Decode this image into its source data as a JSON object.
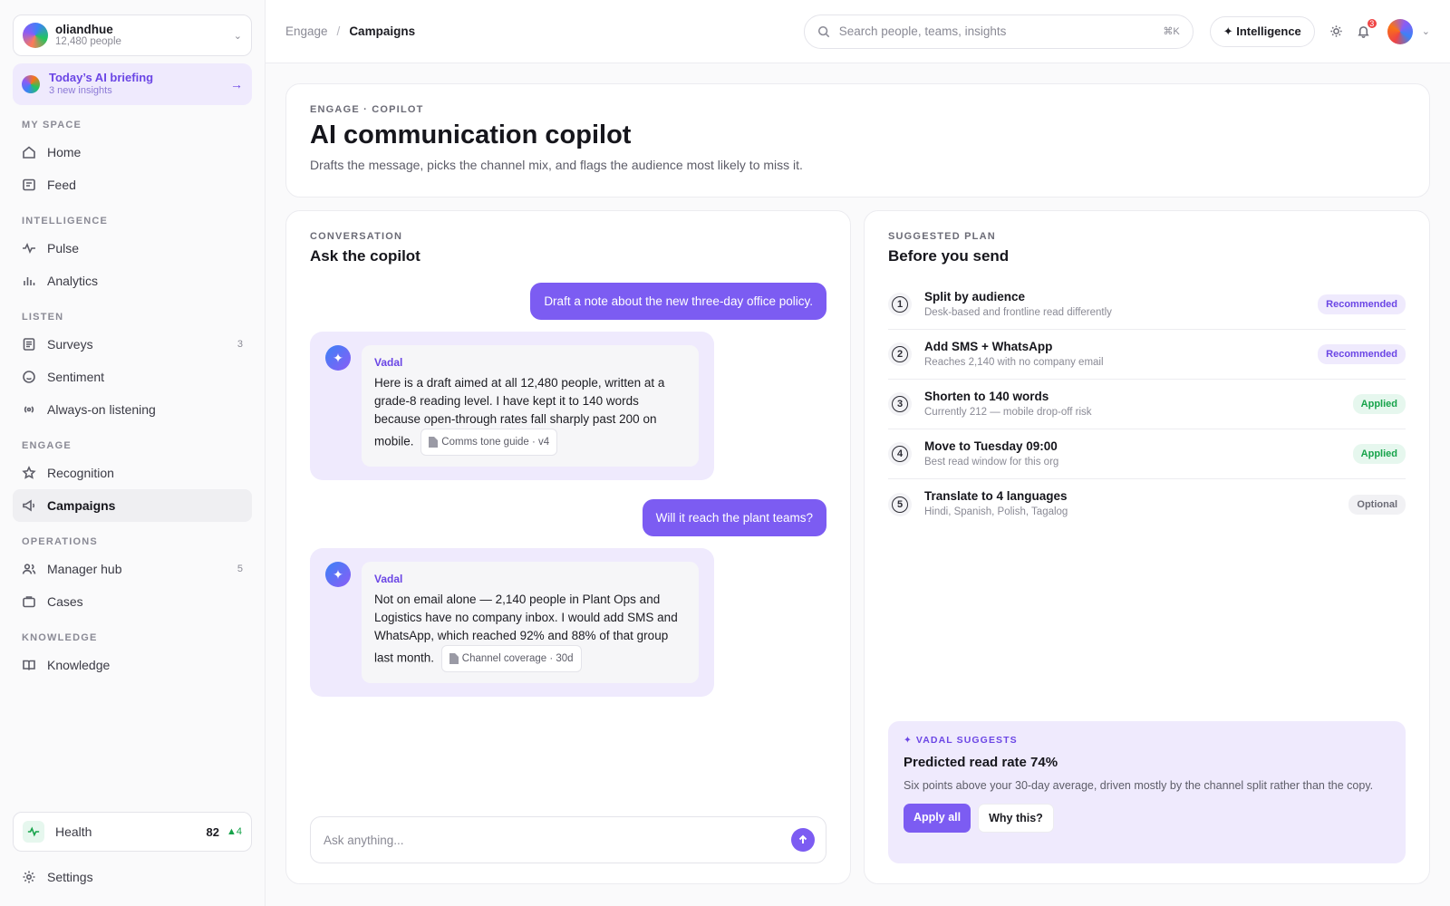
{
  "sidebar": {
    "org": {
      "name": "oliandhue",
      "people": "12,480 people"
    },
    "briefing": {
      "title": "Today’s AI briefing",
      "subtitle": "3 new insights"
    },
    "groups": [
      {
        "title": "MY SPACE",
        "items": [
          {
            "label": "Home",
            "icon": "home-icon"
          },
          {
            "label": "Feed",
            "icon": "feed-icon"
          }
        ]
      },
      {
        "title": "INTELLIGENCE",
        "items": [
          {
            "label": "Pulse",
            "icon": "pulse-icon"
          },
          {
            "label": "Analytics",
            "icon": "bar-chart-icon"
          }
        ]
      },
      {
        "title": "LISTEN",
        "items": [
          {
            "label": "Surveys",
            "icon": "survey-icon",
            "count": "3"
          },
          {
            "label": "Sentiment",
            "icon": "smile-icon"
          },
          {
            "label": "Always-on listening",
            "icon": "broadcast-icon"
          }
        ]
      },
      {
        "title": "ENGAGE",
        "items": [
          {
            "label": "Recognition",
            "icon": "star-icon"
          },
          {
            "label": "Campaigns",
            "icon": "megaphone-icon",
            "active": true
          }
        ]
      },
      {
        "title": "OPERATIONS",
        "items": [
          {
            "label": "Manager hub",
            "icon": "users-icon",
            "count": "5"
          },
          {
            "label": "Cases",
            "icon": "briefcase-icon"
          }
        ]
      },
      {
        "title": "KNOWLEDGE",
        "items": [
          {
            "label": "Knowledge",
            "icon": "book-icon"
          }
        ]
      }
    ],
    "health": {
      "label": "Health",
      "score": "82",
      "delta": "▲4"
    },
    "settings": "Settings"
  },
  "topbar": {
    "breadcrumb": {
      "parent": "Engage",
      "separator": "/",
      "current": "Campaigns"
    },
    "search": {
      "placeholder": "Search people, teams, insights",
      "shortcut": "⌘K"
    },
    "intelligence_label": "✦ Intelligence",
    "notification_count": "3"
  },
  "hero": {
    "eyebrow": "ENGAGE · COPILOT",
    "title": "AI communication copilot",
    "subtitle": "Drafts the message, picks the channel mix, and flags the audience most likely to miss it."
  },
  "conversation": {
    "eyebrow": "CONVERSATION",
    "title": "Ask the copilot",
    "messages": [
      {
        "role": "user",
        "text": "Draft a note about the new three-day office policy."
      },
      {
        "role": "bot",
        "name": "Vadal",
        "text": "Here is a draft aimed at all 12,480 people, written at a grade-8 reading level. I have kept it to 140 words because open-through rates fall sharply past 200 on mobile.",
        "citation": "Comms tone guide · v4"
      },
      {
        "role": "user",
        "text": "Will it reach the plant teams?"
      },
      {
        "role": "bot",
        "name": "Vadal",
        "text": "Not on email alone — 2,140 people in Plant Ops and Logistics have no company inbox. I would add SMS and WhatsApp, which reached 92% and 88% of that group last month.",
        "citation": "Channel coverage · 30d"
      }
    ],
    "composer_placeholder": "Ask anything..."
  },
  "plan": {
    "eyebrow": "SUGGESTED PLAN",
    "title": "Before you send",
    "items": [
      {
        "num": "1",
        "title": "Split by audience",
        "sub": "Desk-based and frontline read differently",
        "status": "Recommended"
      },
      {
        "num": "2",
        "title": "Add SMS + WhatsApp",
        "sub": "Reaches 2,140 with no company email",
        "status": "Recommended"
      },
      {
        "num": "3",
        "title": "Shorten to 140 words",
        "sub": "Currently 212 — mobile drop-off risk",
        "status": "Applied"
      },
      {
        "num": "4",
        "title": "Move to Tuesday 09:00",
        "sub": "Best read window for this org",
        "status": "Applied"
      },
      {
        "num": "5",
        "title": "Translate to 4 languages",
        "sub": "Hindi, Spanish, Polish, Tagalog",
        "status": "Optional"
      }
    ],
    "suggestion": {
      "eyebrow": "✦ VADAL SUGGESTS",
      "title": "Predicted read rate 74%",
      "text": "Six points above your 30-day average, driven mostly by the channel split rather than the copy.",
      "primary": "Apply all",
      "secondary": "Why this?"
    }
  },
  "colors": {
    "accent": "#7c5cf2",
    "accent_soft": "#efeafd",
    "success": "#16a34a",
    "danger": "#ef4444"
  }
}
